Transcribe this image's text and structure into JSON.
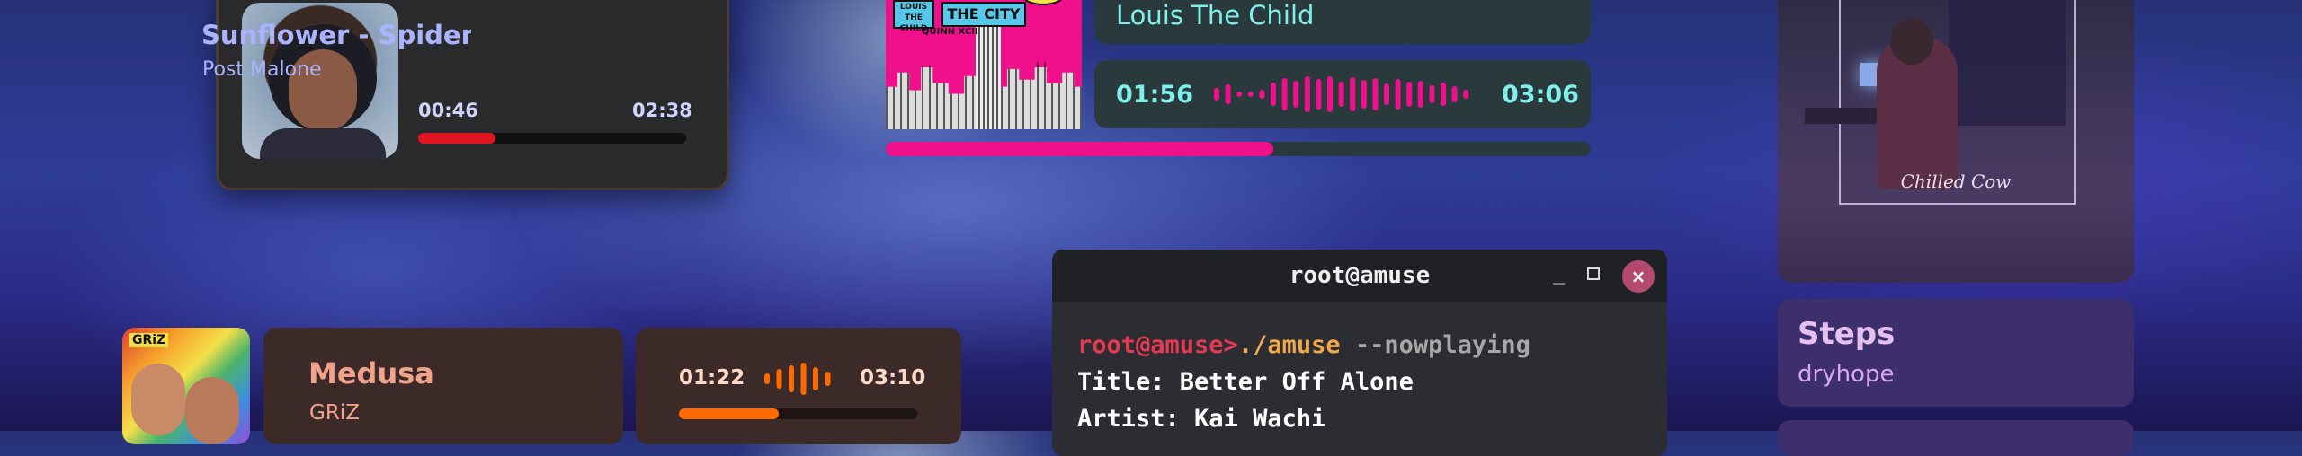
{
  "card_spiderverse": {
    "title": "Sunflower - Spider-Man",
    "artist": "Post Malone",
    "elapsed": "00:46",
    "duration": "02:38",
    "progress": 0.29,
    "accent": "#e0151f"
  },
  "card_city": {
    "artist": "Louis The Child",
    "elapsed": "01:56",
    "duration": "03:06",
    "progress": 0.55,
    "accent": "#f0108c",
    "art_text": {
      "city": "THE CITY",
      "logo": "LOUIS THE CHILD",
      "featured": "QUINN XCII"
    }
  },
  "card_steps": {
    "title": "Steps",
    "artist": "dryhope",
    "art_text": {
      "brand": "Chilled Cow"
    }
  },
  "terminal": {
    "title": "root@amuse",
    "prompt": "root@amuse>",
    "command": "./amuse",
    "argument": " --nowplaying",
    "line_title": "Title: Better Off Alone",
    "line_artist": "Artist: Kai Wachi",
    "min_icon": "minimize-icon",
    "max_icon": "maximize-icon",
    "close_icon": "close-icon",
    "close_glyph": "×"
  },
  "card_medusa": {
    "title": "Medusa",
    "artist": "GRiZ",
    "elapsed": "01:22",
    "duration": "03:10",
    "progress": 0.42,
    "accent": "#ff6a00",
    "art_text": {
      "logo": "GRiZ"
    }
  }
}
